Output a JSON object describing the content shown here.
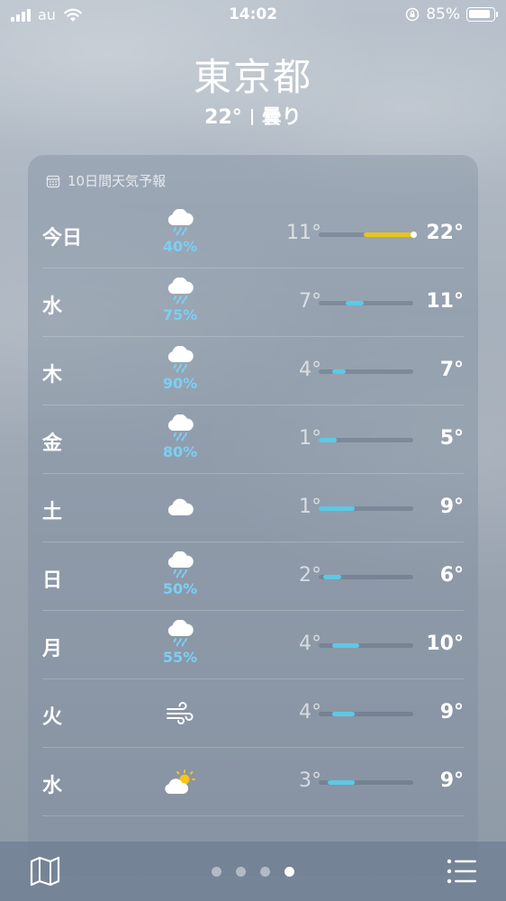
{
  "status_bar": {
    "carrier": "au",
    "time": "14:02",
    "battery": "85%",
    "battery_level": 0.85
  },
  "location": {
    "city": "東京都",
    "current_temp": "22°",
    "condition": "曇り"
  },
  "forecast": {
    "header_icon": "calendar-icon",
    "header": "10日間天気予報",
    "rows": [
      {
        "day": "今日",
        "icon": "cloud-rain-icon",
        "precip": "40%",
        "low": "11°",
        "high": "22°",
        "range": [
          11,
          22
        ],
        "color": "#e6c51d",
        "current": true
      },
      {
        "day": "水",
        "icon": "cloud-rain-icon",
        "precip": "75%",
        "low": "7°",
        "high": "11°",
        "range": [
          7,
          11
        ]
      },
      {
        "day": "木",
        "icon": "cloud-rain-icon",
        "precip": "90%",
        "low": "4°",
        "high": "7°",
        "range": [
          4,
          7
        ]
      },
      {
        "day": "金",
        "icon": "cloud-rain-icon",
        "precip": "80%",
        "low": "1°",
        "high": "5°",
        "range": [
          1,
          5
        ]
      },
      {
        "day": "土",
        "icon": "cloud-icon",
        "precip": "",
        "low": "1°",
        "high": "9°",
        "range": [
          1,
          9
        ]
      },
      {
        "day": "日",
        "icon": "cloud-rain-icon",
        "precip": "50%",
        "low": "2°",
        "high": "6°",
        "range": [
          2,
          6
        ]
      },
      {
        "day": "月",
        "icon": "cloud-rain-icon",
        "precip": "55%",
        "low": "4°",
        "high": "10°",
        "range": [
          4,
          10
        ]
      },
      {
        "day": "火",
        "icon": "wind-icon",
        "precip": "",
        "low": "4°",
        "high": "9°",
        "range": [
          4,
          9
        ]
      },
      {
        "day": "水",
        "icon": "partly-sunny-icon",
        "precip": "",
        "low": "3°",
        "high": "9°",
        "range": [
          3,
          9
        ]
      }
    ],
    "scale": [
      1,
      22
    ]
  },
  "bottom_bar": {
    "left_icon": "map-icon",
    "right_icon": "list-icon",
    "page_count": 4,
    "active_page": 4
  },
  "colors": {
    "precip": "#7ad0f5",
    "bar_cool": "#5bc9e6",
    "bar_warm": "#e6c51d"
  }
}
